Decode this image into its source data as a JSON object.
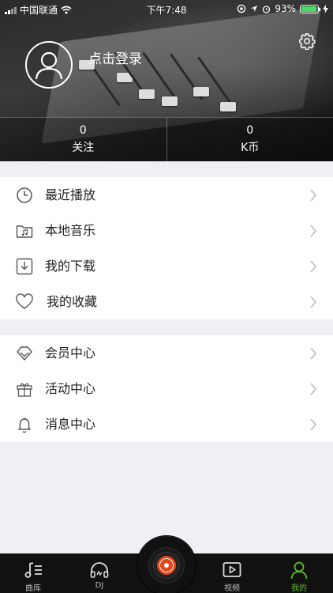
{
  "status_bar": {
    "carrier": "中国联通",
    "time": "下午7:48",
    "battery": "93%",
    "battery_level": 0.93
  },
  "header": {
    "login_text": "点击登录",
    "stats": [
      {
        "value": "0",
        "label": "关注"
      },
      {
        "value": "0",
        "label": "K币"
      }
    ]
  },
  "menu": {
    "section1": [
      {
        "label": "最近播放",
        "icon": "clock-icon"
      },
      {
        "label": "本地音乐",
        "icon": "music-folder-icon"
      },
      {
        "label": "我的下载",
        "icon": "download-icon"
      },
      {
        "label": "我的收藏",
        "icon": "heart-icon"
      }
    ],
    "section2": [
      {
        "label": "会员中心",
        "icon": "diamond-icon"
      },
      {
        "label": "活动中心",
        "icon": "gift-icon"
      },
      {
        "label": "消息中心",
        "icon": "bell-icon"
      }
    ]
  },
  "tabbar": {
    "tabs": [
      {
        "label": "曲库",
        "icon": "music-library-icon"
      },
      {
        "label": "DJ",
        "icon": "headphones-icon"
      },
      {
        "label": "视频",
        "icon": "video-icon"
      },
      {
        "label": "我的",
        "icon": "user-icon"
      }
    ],
    "active_color": "#5dbb2f"
  }
}
